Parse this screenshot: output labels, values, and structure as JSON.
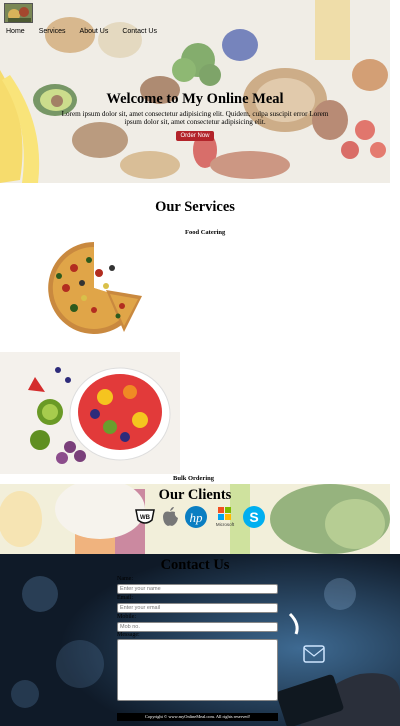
{
  "nav": {
    "items": [
      "Home",
      "Services",
      "About Us",
      "Contact Us"
    ]
  },
  "hero": {
    "title": "Welcome to My Online Meal",
    "text": "Lorem ipsum dolor sit, amet consectetur adipisicing elit. Quidem, culpa suscipit error Lorem ipsum dolor sit, amet consectetur adipisicing elit.",
    "button": "Order Now"
  },
  "services": {
    "title": "Our Services",
    "items": [
      {
        "label": "Food Catering"
      },
      {
        "label": "Bulk Ordering"
      }
    ]
  },
  "clients": {
    "title": "Our Clients",
    "logos": [
      "Warner Bros logo",
      "Apple logo",
      "HP logo",
      "Microsoft",
      "Skype logo"
    ]
  },
  "contact": {
    "title": "Contact Us",
    "name_label": "Name:",
    "name_placeholder": "Enter your name",
    "email_label": "Email:",
    "email_placeholder": "Enter your email",
    "mobile_label": "Mobile:",
    "mobile_placeholder": "Mob no.",
    "message_label": "Message:"
  },
  "footer": {
    "text": "Copyright © www.myOnlineMeal.com. All rights reserved!"
  },
  "colors": {
    "button": "#b3242a",
    "contact_bg": "#1b2c3f",
    "footer_bg": "#000000"
  }
}
